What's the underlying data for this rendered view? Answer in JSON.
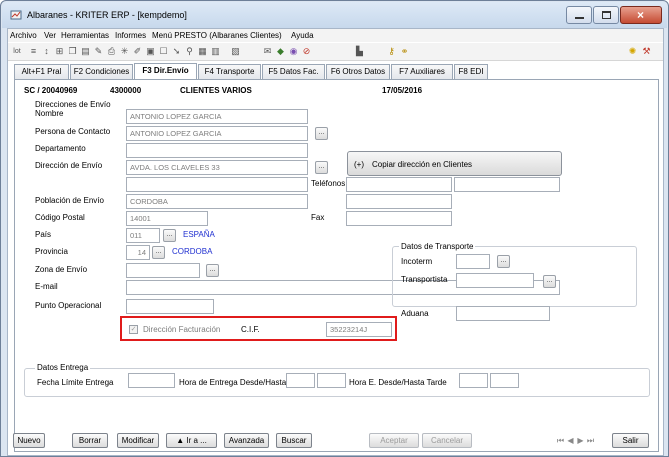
{
  "window": {
    "title": "Albaranes - KRITER ERP -  [kempdemo]"
  },
  "menu": [
    "Archivo",
    "Ver",
    "Herramientas",
    "Informes",
    "Menú PRESTO (Albaranes Clientes)",
    "Ayuda"
  ],
  "toolbar": {
    "icons": [
      "lot-icon",
      "filter-icon",
      "sort-icon",
      "merge-icon",
      "copy-icon",
      "paste-icon",
      "edit-icon",
      "print-icon",
      "star-icon",
      "brush-icon",
      "doc-icon",
      "rect-icon",
      "arrow-icon",
      "pin-icon",
      "calc-icon",
      "table-icon",
      "grid-icon",
      "mail-icon",
      "group-icon",
      "eye-icon",
      "cancel-icon",
      "chart-icon",
      "key-icon",
      "attach-icon",
      "bulb-icon",
      "tools-icon"
    ]
  },
  "tabs": [
    {
      "label": "Alt+F1 Pral"
    },
    {
      "label": "F2 Condiciones"
    },
    {
      "label": "F3 Dir.Envío"
    },
    {
      "label": "F4 Transporte"
    },
    {
      "label": "F5 Datos Fac."
    },
    {
      "label": "F6 Otros Datos"
    },
    {
      "label": "F7 Auxiliares"
    },
    {
      "label": "F8 EDI"
    }
  ],
  "header": {
    "doc_number": "SC / 20040969",
    "client_code": "4300000",
    "client_name": "CLIENTES VARIOS",
    "date": "17/05/2016"
  },
  "shipping": {
    "section_title": "Direcciones de Envío",
    "name_label": "Nombre",
    "name_value": "ANTONIO LOPEZ GARCIA",
    "contact_label": "Persona de Contacto",
    "contact_value": "ANTONIO LOPEZ GARCIA",
    "department_label": "Departamento",
    "department_value": "",
    "address_label": "Dirección de Envío",
    "address_value": "AVDA. LOS CLAVELES 33",
    "address2_value": "",
    "phones_label": "Teléfonos",
    "city_label": "Población de Envío",
    "city_value": "CORDOBA",
    "postal_label": "Código Postal",
    "postal_value": "14001",
    "fax_label": "Fax",
    "country_label": "País",
    "country_code": "011",
    "country_name": "ESPAÑA",
    "province_label": "Provincia",
    "province_code": "14",
    "province_name": "CORDOBA",
    "zone_label": "Zona de Envío",
    "email_label": "E-mail",
    "op_point_label": "Punto Operacional",
    "copy_button": "Copiar dirección en Clientes"
  },
  "transport": {
    "section_title": "Datos de Transporte",
    "incoterm_label": "Incoterm",
    "carrier_label": "Transportista",
    "customs_label": "Aduana"
  },
  "billing": {
    "checkbox_label": "Dirección Facturación",
    "cif_label": "C.I.F.",
    "cif_value": "35223214J"
  },
  "delivery": {
    "section_title": "Datos Entrega",
    "limit_date_label": "Fecha Límite Entrega",
    "from_to_label": "Hora de Entrega Desde/Hasta",
    "late_label": "Hora E. Desde/Hasta Tarde"
  },
  "buttons": {
    "new": "Nuevo",
    "delete": "Borrar",
    "modify": "Modificar",
    "goto": "Ir a ...",
    "advanced": "Avanzada",
    "search": "Buscar",
    "accept": "Aceptar",
    "cancel": "Cancelar",
    "exit": "Salir"
  },
  "colors": {
    "highlight_border": "#e01b1b",
    "link_text": "#1f2fd0"
  }
}
